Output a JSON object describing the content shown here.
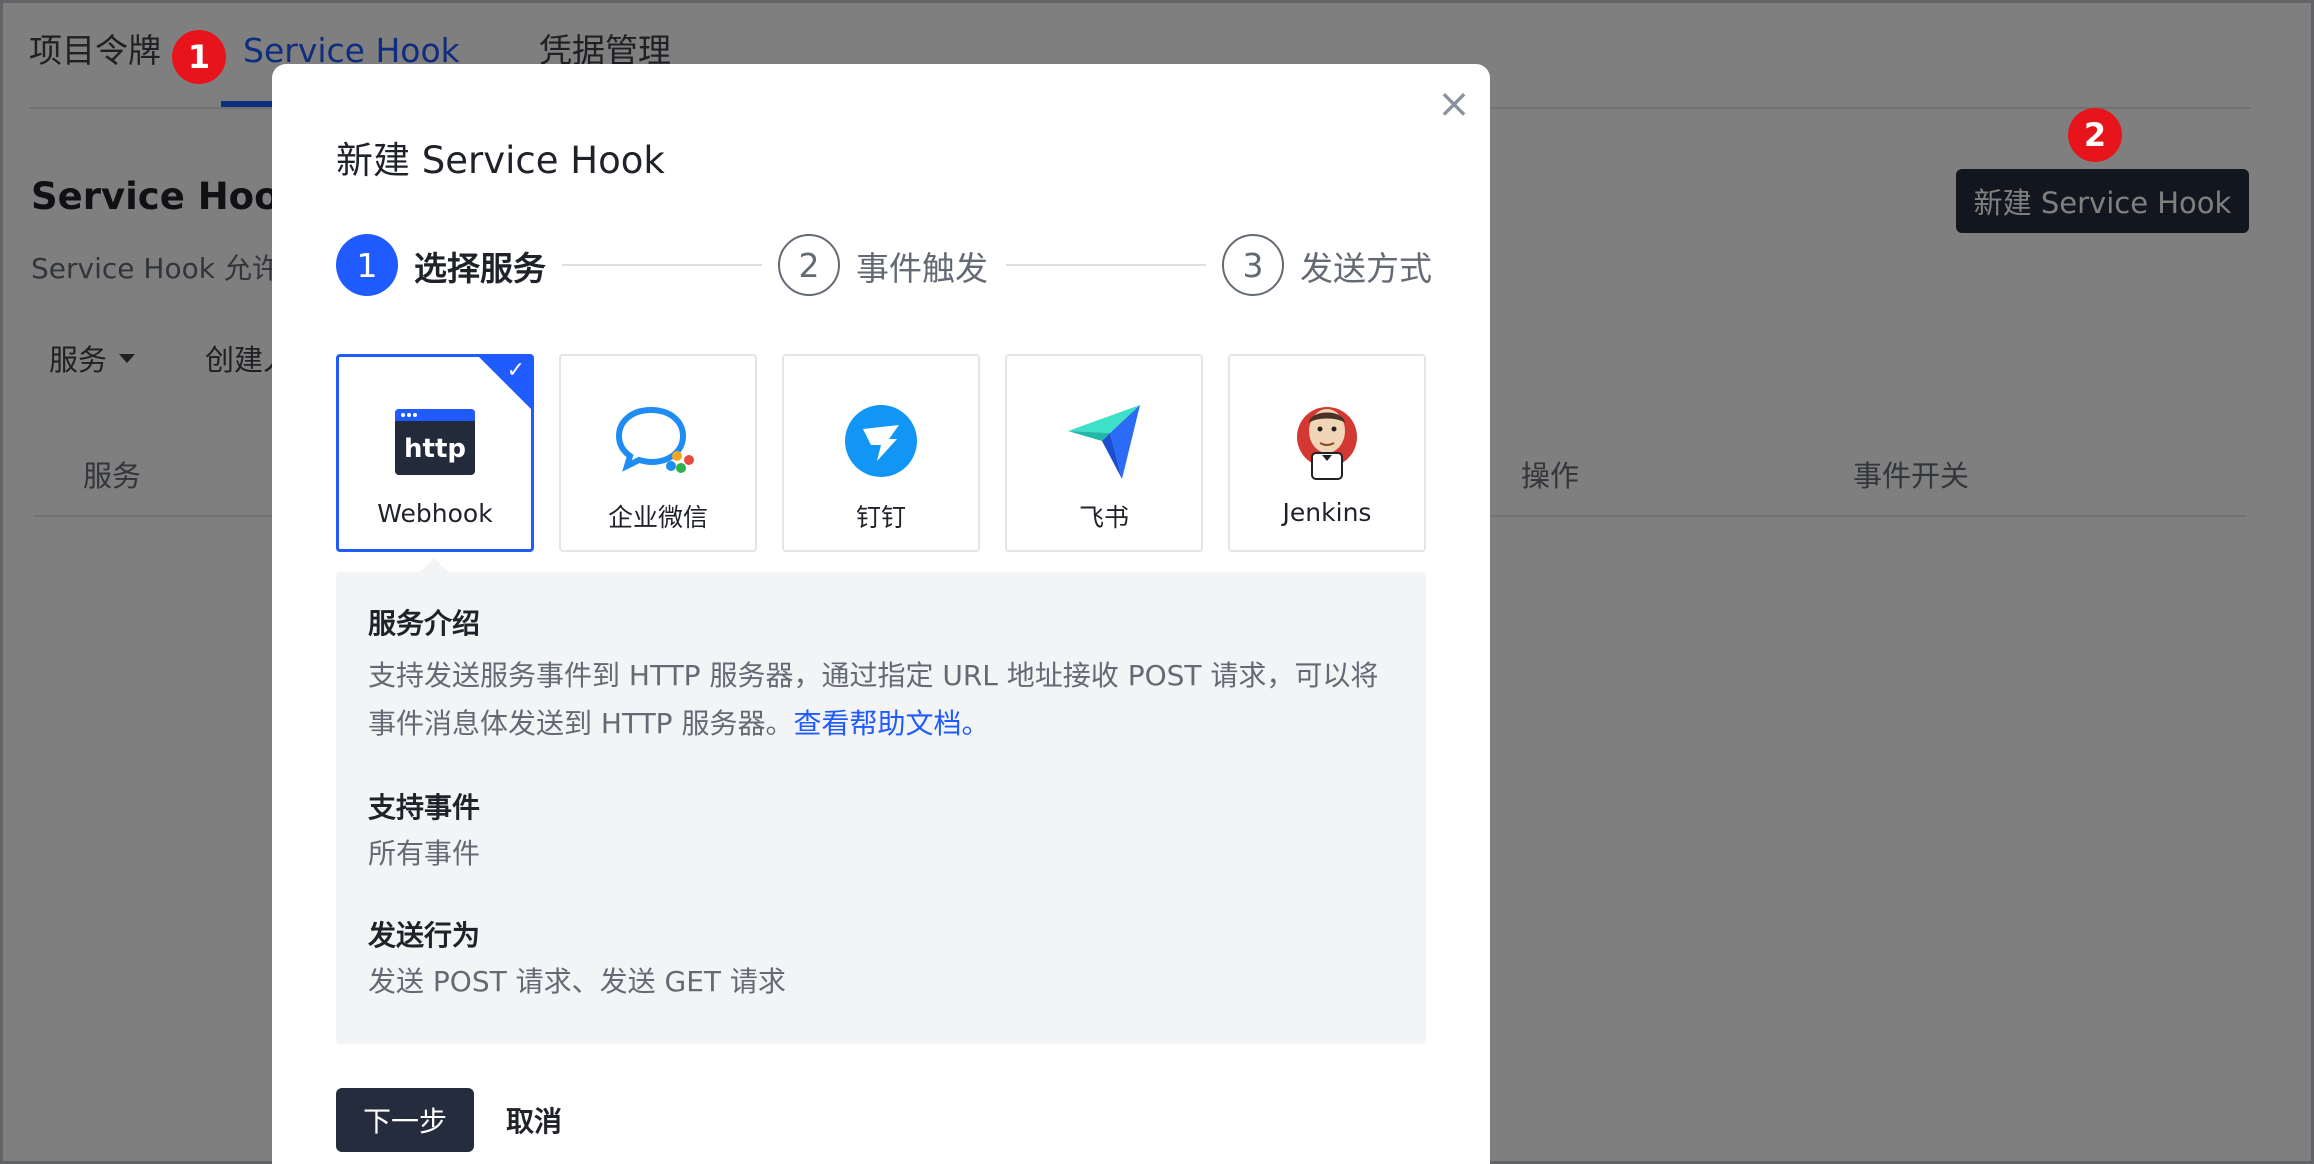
{
  "tabs": [
    {
      "label": "项目令牌"
    },
    {
      "label": "Service Hook"
    },
    {
      "label": "凭据管理"
    }
  ],
  "page": {
    "title": "Service Hook",
    "description": "Service Hook 允许",
    "new_button": "新建 Service Hook",
    "filters": [
      {
        "label": "服务"
      },
      {
        "label": "创建人"
      }
    ],
    "table_headers": [
      "服务",
      "操作",
      "事件开关"
    ]
  },
  "badges": [
    "1",
    "2"
  ],
  "modal": {
    "title": "新建 Service Hook",
    "close_icon": "close-icon",
    "steps": [
      {
        "number": "1",
        "label": "选择服务"
      },
      {
        "number": "2",
        "label": "事件触发"
      },
      {
        "number": "3",
        "label": "发送方式"
      }
    ],
    "services": [
      {
        "label": "Webhook",
        "icon": "http-icon"
      },
      {
        "label": "企业微信",
        "icon": "wecom-icon"
      },
      {
        "label": "钉钉",
        "icon": "dingtalk-icon"
      },
      {
        "label": "飞书",
        "icon": "feishu-icon"
      },
      {
        "label": "Jenkins",
        "icon": "jenkins-icon"
      }
    ],
    "info": {
      "intro_title": "服务介绍",
      "intro_text": "支持发送服务事件到 HTTP 服务器，通过指定 URL 地址接收 POST 请求，可以将事件消息体发送到 HTTP 服务器。",
      "intro_link": "查看帮助文档。",
      "events_title": "支持事件",
      "events_text": "所有事件",
      "action_title": "发送行为",
      "action_text": "发送 POST 请求、发送 GET 请求"
    },
    "next_button": "下一步",
    "cancel_button": "取消"
  },
  "colors": {
    "accent": "#1f5bff",
    "dark_button": "#252c3d",
    "badge": "#e8141b"
  }
}
